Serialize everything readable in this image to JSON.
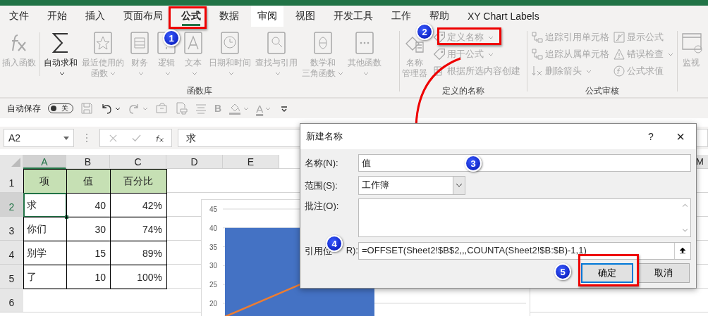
{
  "tabs": [
    {
      "label": "文件",
      "selected": false,
      "highlighted": false
    },
    {
      "label": "开始",
      "selected": false,
      "highlighted": false
    },
    {
      "label": "插入",
      "selected": false,
      "highlighted": false
    },
    {
      "label": "页面布局",
      "selected": false,
      "highlighted": false
    },
    {
      "label": "公式",
      "selected": true,
      "highlighted": false
    },
    {
      "label": "数据",
      "selected": false,
      "highlighted": false
    },
    {
      "label": "审阅",
      "selected": false,
      "highlighted": true
    },
    {
      "label": "视图",
      "selected": false,
      "highlighted": false
    },
    {
      "label": "开发工具",
      "selected": false,
      "highlighted": false
    },
    {
      "label": "工作",
      "selected": false,
      "highlighted": false
    },
    {
      "label": "帮助",
      "selected": false,
      "highlighted": false
    },
    {
      "label": "XY Chart Labels",
      "selected": false,
      "highlighted": false
    }
  ],
  "ribbon": {
    "function_library": {
      "label": "函数库",
      "items": [
        {
          "kind": "fx",
          "lines": [
            "插入函数"
          ],
          "dropdown": false,
          "disabled": true
        },
        {
          "kind": "sum",
          "lines": [
            "自动求和"
          ],
          "dropdown": true,
          "disabled": false
        },
        {
          "kind": "star",
          "lines": [
            "最近使用的",
            "函数"
          ],
          "dropdown": true,
          "disabled": true
        },
        {
          "kind": "coins",
          "lines": [
            "财务"
          ],
          "dropdown": true,
          "disabled": true
        },
        {
          "kind": "question",
          "lines": [
            "逻辑"
          ],
          "dropdown": true,
          "disabled": true
        },
        {
          "kind": "letter",
          "lines": [
            "文本"
          ],
          "dropdown": true,
          "disabled": true
        },
        {
          "kind": "clock",
          "lines": [
            "日期和时间"
          ],
          "dropdown": true,
          "disabled": true
        },
        {
          "kind": "search",
          "lines": [
            "查找与引用"
          ],
          "dropdown": true,
          "disabled": true
        },
        {
          "kind": "theta",
          "lines": [
            "数学和",
            "三角函数"
          ],
          "dropdown": true,
          "disabled": true
        },
        {
          "kind": "dots",
          "lines": [
            "其他函数"
          ],
          "dropdown": true,
          "disabled": true
        }
      ]
    },
    "defined_names": {
      "label": "定义的名称",
      "manager": {
        "lines": [
          "名称",
          "管理器"
        ],
        "disabled": true
      },
      "items": [
        {
          "kind": "tag",
          "label": "定义名称",
          "dropdown": true,
          "disabled": true
        },
        {
          "kind": "tag",
          "label": "用于公式",
          "dropdown": true,
          "disabled": true
        },
        {
          "kind": "grid",
          "label": "根据所选内容创建",
          "dropdown": false,
          "disabled": true
        }
      ]
    },
    "formula_auditing": {
      "label": "公式审核",
      "columns": [
        [
          {
            "kind": "trace",
            "label": "追踪引用单元格",
            "dropdown": false,
            "disabled": true
          },
          {
            "kind": "trace",
            "label": "追踪从属单元格",
            "dropdown": false,
            "disabled": true
          },
          {
            "kind": "remove",
            "label": "删除箭头",
            "dropdown": true,
            "disabled": true
          }
        ],
        [
          {
            "kind": "formula",
            "label": "显示公式",
            "dropdown": false,
            "disabled": true
          },
          {
            "kind": "warning",
            "label": "错误检查",
            "dropdown": true,
            "disabled": true
          },
          {
            "kind": "evaluate",
            "label": "公式求值",
            "dropdown": false,
            "disabled": true
          }
        ]
      ]
    },
    "watch": {
      "lines": [
        "监视"
      ],
      "disabled": true
    }
  },
  "quick_access": {
    "autosave": {
      "label": "自动保存",
      "on": false,
      "state_label": "关"
    },
    "buttons": [
      {
        "kind": "save",
        "dropdown": false,
        "disabled": true
      },
      {
        "kind": "undo",
        "dropdown": true,
        "disabled": false
      },
      {
        "kind": "redo",
        "dropdown": true,
        "disabled": true
      },
      {
        "kind": "camera",
        "dropdown": false,
        "disabled": true
      },
      {
        "kind": "print",
        "dropdown": false,
        "disabled": true
      },
      {
        "kind": "align",
        "dropdown": false,
        "disabled": true
      },
      {
        "kind": "bold",
        "label": "B",
        "dropdown": false,
        "disabled": true
      },
      {
        "kind": "fill",
        "dropdown": true,
        "disabled": true
      },
      {
        "kind": "font-color",
        "label": "A",
        "dropdown": true,
        "disabled": true
      },
      {
        "kind": "customize",
        "dropdown": false,
        "disabled": false
      }
    ]
  },
  "formula_bar": {
    "name_box": "A2",
    "formula": "求"
  },
  "sheet": {
    "columns": [
      {
        "label": "A",
        "selected": true
      },
      {
        "label": "B",
        "selected": false
      },
      {
        "label": "C",
        "selected": false
      },
      {
        "label": "D",
        "selected": false
      },
      {
        "label": "E",
        "selected": false
      },
      {
        "label": "M",
        "selected": false
      }
    ],
    "rows": [
      {
        "label": "1",
        "selected": false,
        "kind": "header",
        "cells": [
          {
            "text": "项",
            "selected": false
          },
          {
            "text": "值",
            "selected": false
          },
          {
            "text": "百分比",
            "selected": false
          }
        ]
      },
      {
        "label": "2",
        "selected": true,
        "kind": "data",
        "cells": [
          {
            "text": "求",
            "selected": true
          },
          {
            "text": "40",
            "selected": false
          },
          {
            "text": "42%",
            "selected": false
          }
        ]
      },
      {
        "label": "3",
        "selected": false,
        "kind": "data",
        "cells": [
          {
            "text": "你们",
            "selected": false
          },
          {
            "text": "30",
            "selected": false
          },
          {
            "text": "74%",
            "selected": false
          }
        ]
      },
      {
        "label": "4",
        "selected": false,
        "kind": "data",
        "cells": [
          {
            "text": "别学",
            "selected": false
          },
          {
            "text": "15",
            "selected": false
          },
          {
            "text": "89%",
            "selected": false
          }
        ]
      },
      {
        "label": "5",
        "selected": false,
        "kind": "data",
        "cells": [
          {
            "text": "了",
            "selected": false
          },
          {
            "text": "10",
            "selected": false
          },
          {
            "text": "100%",
            "selected": false
          }
        ]
      },
      {
        "label": "6",
        "selected": false
      }
    ],
    "chart": {
      "chart_data": {
        "type": "bar",
        "ylim": [
          0,
          45
        ],
        "grid": true,
        "yticks": [
          20,
          25,
          30,
          35,
          40,
          45
        ],
        "series": [
          {
            "color": "#4472c4",
            "values": [
              40
            ]
          }
        ]
      }
    }
  },
  "dialog": {
    "title": "新建名称",
    "help": "?",
    "close": "×",
    "name": {
      "label": "名称(N):",
      "value": "值"
    },
    "scope": {
      "label": "范围(S):",
      "value": "工作簿"
    },
    "comment": {
      "label": "批注(O):"
    },
    "refers_to": {
      "label_parts": [
        "引用位",
        "R):"
      ],
      "value": "=OFFSET(Sheet2!$B$2,,,COUNTA(Sheet2!$B:$B)-1,1)"
    },
    "buttons": [
      {
        "label": "确定",
        "default": true
      },
      {
        "label": "取消",
        "default": false
      }
    ]
  },
  "annotations": [
    {
      "label": "1"
    },
    {
      "label": "2"
    },
    {
      "label": "3"
    },
    {
      "label": "4"
    },
    {
      "label": "5"
    }
  ]
}
